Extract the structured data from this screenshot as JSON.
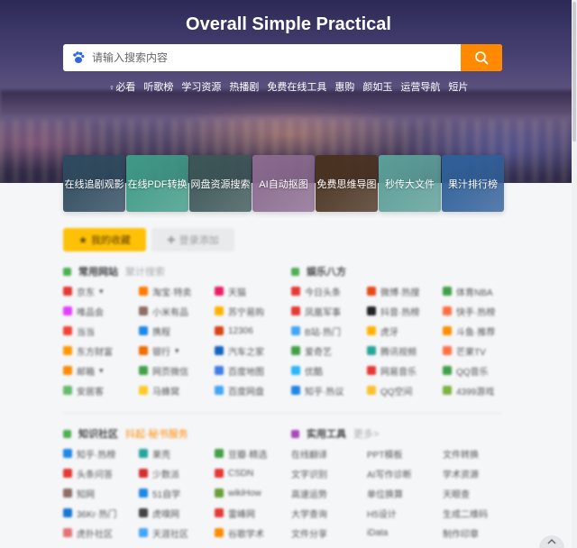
{
  "page": {
    "title": "Overall Simple Practical"
  },
  "search": {
    "placeholder": "请输入搜索内容",
    "engine_icon": "baidu-paw-icon",
    "button_icon": "search-icon"
  },
  "quicklinks": [
    {
      "label": "必看",
      "highlight": false,
      "icon": "bulb-icon"
    },
    {
      "label": "听歌榜",
      "highlight": false
    },
    {
      "label": "学习资源",
      "highlight": true
    },
    {
      "label": "热播剧",
      "highlight": false
    },
    {
      "label": "免费在线工具",
      "highlight": true
    },
    {
      "label": "惠购",
      "highlight": false
    },
    {
      "label": "颜如玉",
      "highlight": false
    },
    {
      "label": "运营导航",
      "highlight": false
    },
    {
      "label": "短片",
      "highlight": false
    }
  ],
  "cards": [
    {
      "label": "在线追剧观影",
      "color": "#2e4a5e"
    },
    {
      "label": "在线PDF转换",
      "color": "#3f9a86"
    },
    {
      "label": "网盘资源搜索",
      "color": "#3c5657"
    },
    {
      "label": "AI自动抠图",
      "color": "#8a6a8e"
    },
    {
      "label": "免费思维导图",
      "color": "#4a3220"
    },
    {
      "label": "秒传大文件",
      "color": "#5b9e98"
    },
    {
      "label": "果汁排行榜",
      "color": "#2f5f98"
    }
  ],
  "tabs": {
    "my_favorites": "我的收藏",
    "login_add": "登录添加"
  },
  "sections": {
    "common_sites": {
      "title": "常用网站",
      "sub": "聚计搜索",
      "color": "#4caf50",
      "items": [
        {
          "label": "京东",
          "color": "#e53935",
          "dropdown": true
        },
        {
          "label": "淘宝·特卖",
          "color": "#ff7a00"
        },
        {
          "label": "天猫",
          "color": "#e91e63"
        },
        {
          "label": "唯品会",
          "color": "#e040fb"
        },
        {
          "label": "小米有品",
          "color": "#8d6e63"
        },
        {
          "label": "苏宁易购",
          "color": "#ffb300"
        },
        {
          "label": "当当",
          "color": "#f44336"
        },
        {
          "label": "携程",
          "color": "#1e88e5"
        },
        {
          "label": "12306",
          "color": "#d84315"
        },
        {
          "label": "东方财富",
          "color": "#ff9800"
        },
        {
          "label": "银行",
          "color": "#ef6c00",
          "dropdown": true
        },
        {
          "label": "汽车之家",
          "color": "#1565c0"
        },
        {
          "label": "邮箱",
          "color": "#fb8c00",
          "dropdown": true
        },
        {
          "label": "网页微信",
          "color": "#43a047"
        },
        {
          "label": "百度地图",
          "color": "#3f7de3"
        },
        {
          "label": "安居客",
          "color": "#66bb6a"
        },
        {
          "label": "马蜂窝",
          "color": "#ffca28"
        },
        {
          "label": "百度网盘",
          "color": "#42a5f5"
        }
      ]
    },
    "entertainment": {
      "title": "娱乐八方",
      "color": "#4caf50",
      "items": [
        {
          "label": "今日头条",
          "color": "#e53935"
        },
        {
          "label": "微博·热搜",
          "color": "#e64a19"
        },
        {
          "label": "体育NBA",
          "color": "#43a047"
        },
        {
          "label": "凤凰军事",
          "color": "#e53935"
        },
        {
          "label": "抖音·热榜",
          "color": "#222222"
        },
        {
          "label": "快手·热榜",
          "color": "#ff7043"
        },
        {
          "label": "B站·热门",
          "color": "#42a5f5"
        },
        {
          "label": "虎牙",
          "color": "#ffb300"
        },
        {
          "label": "斗鱼·推荐",
          "color": "#ff8f00"
        },
        {
          "label": "爱奇艺",
          "color": "#43a047"
        },
        {
          "label": "腾讯视频",
          "color": "#26a69a"
        },
        {
          "label": "芒果TV",
          "color": "#ff7043"
        },
        {
          "label": "优酷",
          "color": "#29b6f6"
        },
        {
          "label": "网易音乐",
          "color": "#e53935"
        },
        {
          "label": "QQ音乐",
          "color": "#43a047"
        },
        {
          "label": "知乎·热议",
          "color": "#1e88e5"
        },
        {
          "label": "QQ空间",
          "color": "#fbc02d"
        },
        {
          "label": "4399游戏",
          "color": "#7cb342"
        }
      ]
    },
    "knowledge": {
      "title": "知识社区",
      "sub": "抖起·秘书服务",
      "color": "#4caf50",
      "items": [
        {
          "label": "知乎·热榜",
          "color": "#1e88e5"
        },
        {
          "label": "果壳",
          "color": "#26a69a"
        },
        {
          "label": "豆瓣·精选",
          "color": "#43a047"
        },
        {
          "label": "头条问答",
          "color": "#e53935"
        },
        {
          "label": "少数派",
          "color": "#d32f2f"
        },
        {
          "label": "CSDN",
          "color": "#e53935"
        },
        {
          "label": "知网",
          "color": "#8d6e63"
        },
        {
          "label": "51自学",
          "color": "#1e88e5"
        },
        {
          "label": "wikiHow",
          "color": "#689f38"
        },
        {
          "label": "36Kr·热门",
          "color": "#1976d2"
        },
        {
          "label": "虎嗅网",
          "color": "#424242"
        },
        {
          "label": "雷峰网",
          "color": "#e53935"
        },
        {
          "label": "虎扑社区",
          "color": "#e57373"
        },
        {
          "label": "天涯社区",
          "color": "#42a5f5"
        },
        {
          "label": "谷歌学术",
          "color": "#fb8c00"
        }
      ]
    },
    "tools": {
      "title": "实用工具",
      "sub": "更多>",
      "color": "#ab47bc",
      "items": [
        {
          "label": "在线翻译"
        },
        {
          "label": "PPT模板"
        },
        {
          "label": "文件转换"
        },
        {
          "label": "文字识别"
        },
        {
          "label": "AI写作诊断"
        },
        {
          "label": "学术资源"
        },
        {
          "label": "高速运势"
        },
        {
          "label": "单位换算"
        },
        {
          "label": "天眼查"
        },
        {
          "label": "大学查询"
        },
        {
          "label": "H5设计"
        },
        {
          "label": "生成二维码"
        },
        {
          "label": "文件分享"
        },
        {
          "label": "iData"
        },
        {
          "label": "制作印章"
        }
      ]
    }
  }
}
